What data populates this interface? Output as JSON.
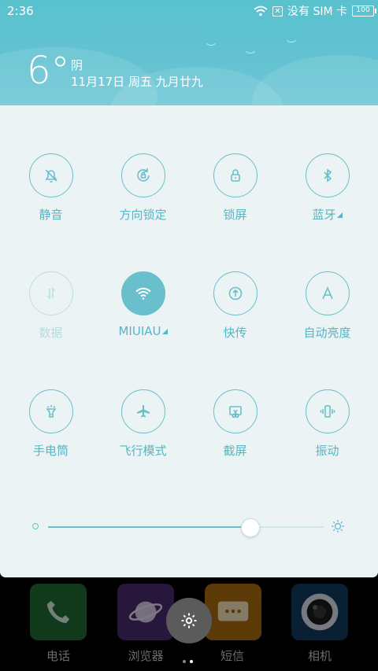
{
  "status_bar": {
    "time": "2:36",
    "carrier": "没有 SIM 卡",
    "battery": "100"
  },
  "weather": {
    "temperature": "6°",
    "condition": "阴",
    "date": "11月17日 周五 九月廿九"
  },
  "toggles": [
    {
      "label": "静音",
      "icon": "bell-off-icon",
      "state": "off"
    },
    {
      "label": "方向锁定",
      "icon": "rotation-lock-icon",
      "state": "off"
    },
    {
      "label": "锁屏",
      "icon": "lock-icon",
      "state": "off"
    },
    {
      "label": "蓝牙",
      "icon": "bluetooth-icon",
      "state": "off"
    },
    {
      "label": "数据",
      "icon": "data-arrows-icon",
      "state": "disabled"
    },
    {
      "label": "MIUIAU",
      "icon": "wifi-icon",
      "state": "on"
    },
    {
      "label": "快传",
      "icon": "upload-icon",
      "state": "off"
    },
    {
      "label": "自动亮度",
      "icon": "auto-brightness-icon",
      "state": "off"
    },
    {
      "label": "手电筒",
      "icon": "flashlight-icon",
      "state": "off"
    },
    {
      "label": "飞行模式",
      "icon": "airplane-icon",
      "state": "off"
    },
    {
      "label": "截屏",
      "icon": "screenshot-icon",
      "state": "off"
    },
    {
      "label": "振动",
      "icon": "vibrate-icon",
      "state": "off"
    }
  ],
  "brightness": {
    "level": 0.73
  },
  "dock": [
    {
      "label": "电话",
      "icon": "phone-icon"
    },
    {
      "label": "浏览器",
      "icon": "browser-icon"
    },
    {
      "label": "短信",
      "icon": "sms-icon"
    },
    {
      "label": "相机",
      "icon": "camera-icon"
    }
  ],
  "colors": {
    "accent": "#69bfcc",
    "header": "#63c2d1",
    "panel": "#ecf3f4"
  }
}
